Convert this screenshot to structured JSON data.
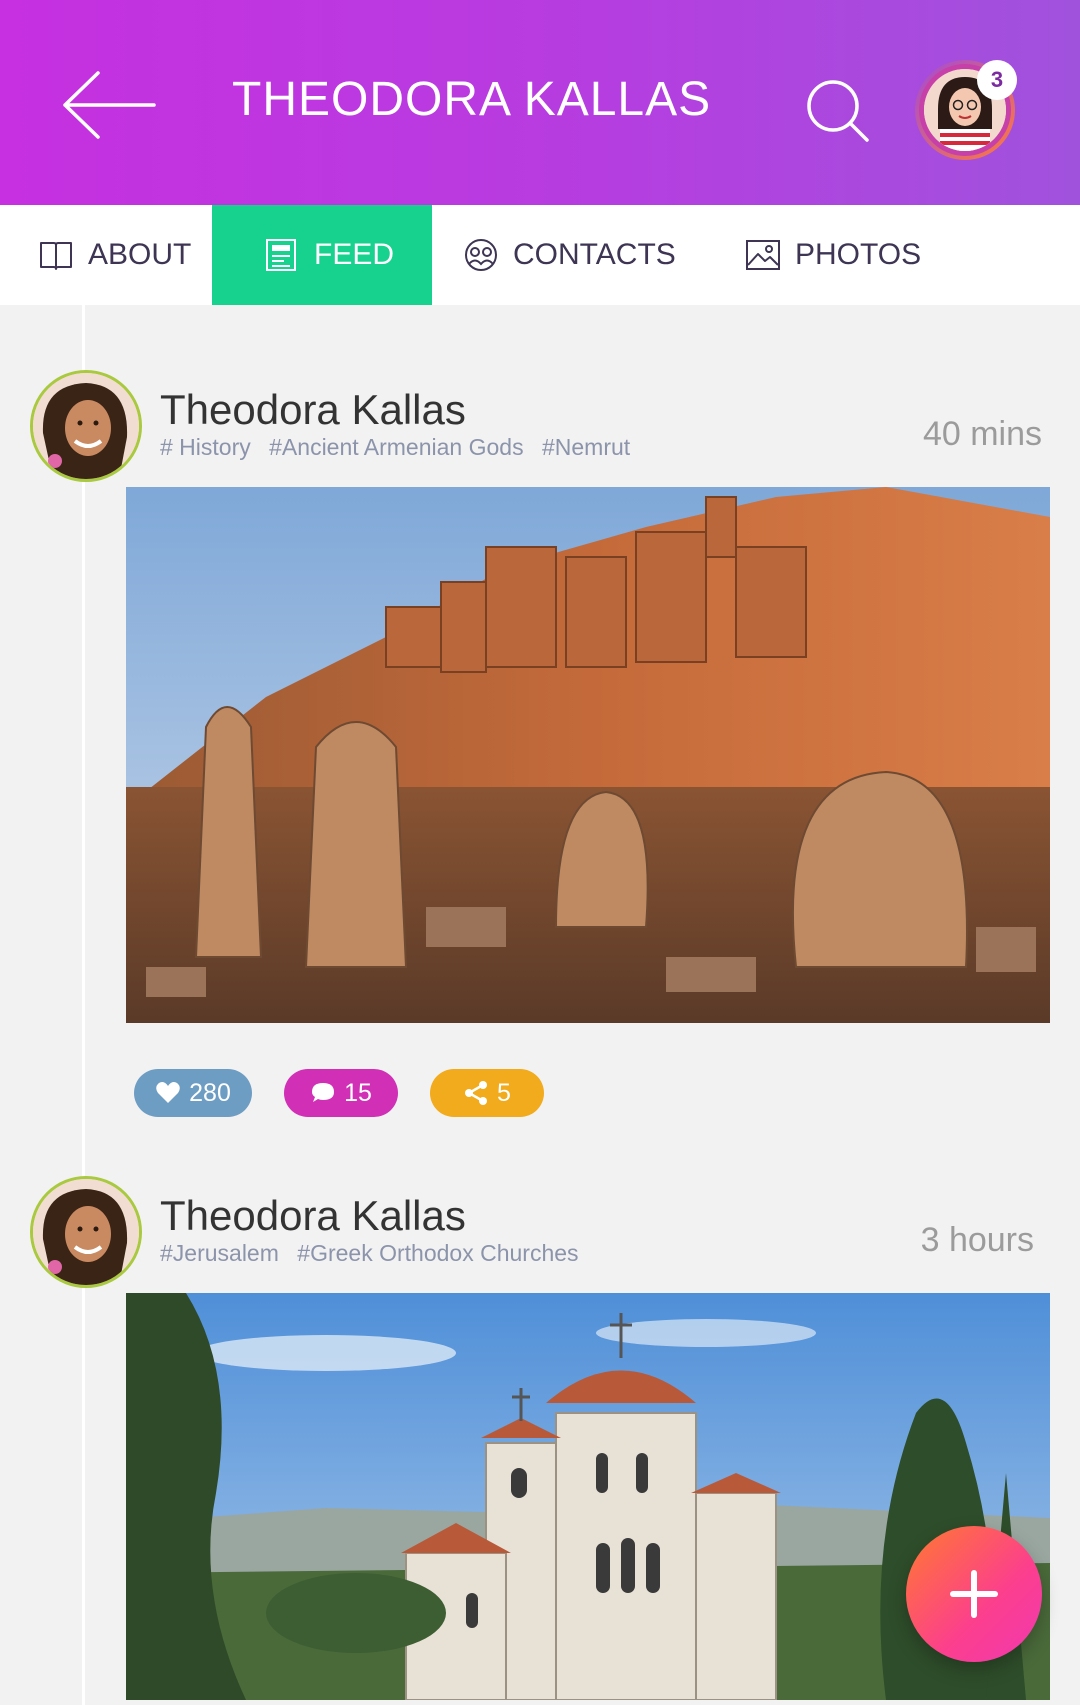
{
  "header": {
    "title": "THEODORA KALLAS",
    "notification_count": "3",
    "colors": {
      "gradient_start": "#c630e0",
      "gradient_end": "#a052dd"
    }
  },
  "tabs": [
    {
      "label": "ABOUT",
      "icon": "book-icon",
      "active": false
    },
    {
      "label": "FEED",
      "icon": "newspaper-icon",
      "active": true
    },
    {
      "label": "CONTACTS",
      "icon": "people-icon",
      "active": false
    },
    {
      "label": "PHOTOS",
      "icon": "image-icon",
      "active": false
    }
  ],
  "posts": [
    {
      "author": "Theodora Kallas",
      "tags": [
        "# History",
        "#Ancient Armenian Gods",
        "#Nemrut"
      ],
      "time": "40 mins",
      "image": "mount-nemrut-statues",
      "likes": "280",
      "comments": "15",
      "shares": "5"
    },
    {
      "author": "Theodora Kallas",
      "tags": [
        "#Jerusalem",
        "#Greek Orthodox Churches"
      ],
      "time": "3 hours",
      "image": "greek-orthodox-church"
    }
  ],
  "colors": {
    "active_tab": "#17d18f",
    "like": "#6e9dc4",
    "comment": "#d02fb6",
    "share": "#f1ab1c",
    "fab": "#fc3f8d"
  }
}
